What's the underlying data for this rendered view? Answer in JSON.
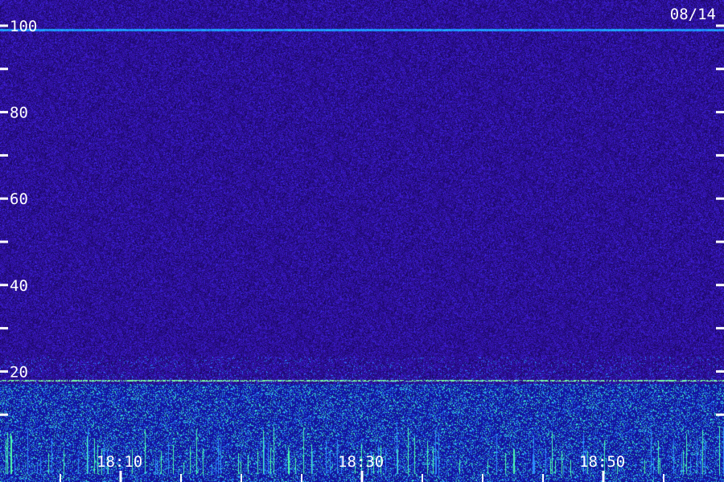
{
  "date_label": "08/14",
  "chart_data": {
    "type": "heatmap",
    "title": "",
    "xlabel": "",
    "ylabel": "",
    "ylim": [
      0,
      100
    ],
    "y_ticks_labeled": [
      "100",
      "80",
      "60",
      "40",
      "20"
    ],
    "y_tick_values_labeled": [
      100,
      80,
      60,
      40,
      20
    ],
    "y_tick_values_minor": [
      90,
      70,
      50,
      30,
      10
    ],
    "x_tick_labels": [
      "18:10",
      "18:30",
      "18:50"
    ],
    "xlim": [
      "18:00",
      "19:00"
    ],
    "x_tick_times": [
      "18:10",
      "18:30",
      "18:50"
    ],
    "x_minor_ticks_minutes": [
      5,
      15,
      20,
      25,
      35,
      40,
      45,
      55
    ],
    "grid": false,
    "colors": {
      "background": "#1e0a6e",
      "noise_low": "#2a0fa0",
      "noise_high": "#4a2cff",
      "band_line": "#2f8cff",
      "strong_signal": "#4dffb0",
      "axis": "#ffffff"
    },
    "features": [
      {
        "label": "line",
        "value": 99
      },
      {
        "label": "band",
        "value": 18
      }
    ]
  }
}
